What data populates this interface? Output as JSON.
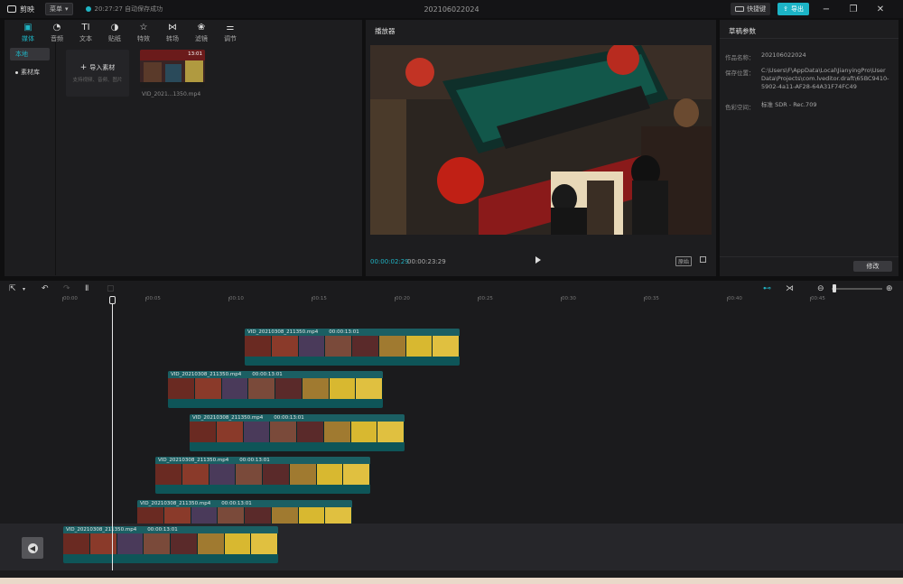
{
  "app": {
    "name": "剪映",
    "menu_label": "菜单",
    "save_status": "20:27:27 自动保存成功",
    "project_title": "202106022024"
  },
  "topbar": {
    "shortcut_label": "快捷键",
    "export_label": "导出"
  },
  "colors": {
    "accent": "#1fb4c4",
    "panel_bg": "#1d1d1f",
    "window_bg": "#0f0f10"
  },
  "media_tabs": [
    {
      "label": "媒体",
      "icon": "media-icon",
      "active": true
    },
    {
      "label": "音频",
      "icon": "audio-icon"
    },
    {
      "label": "文本",
      "icon": "text-icon"
    },
    {
      "label": "贴纸",
      "icon": "sticker-icon"
    },
    {
      "label": "特效",
      "icon": "effects-icon"
    },
    {
      "label": "转场",
      "icon": "transition-icon"
    },
    {
      "label": "滤镜",
      "icon": "filter-icon"
    },
    {
      "label": "调节",
      "icon": "adjust-icon"
    }
  ],
  "media_side": {
    "local": "本地",
    "library": "素材库"
  },
  "media": {
    "import_label": "导入素材",
    "import_hint": "支持视频、音频、图片",
    "clip_name": "VID_2021...1350.mp4",
    "clip_duration": "13:01"
  },
  "player": {
    "title": "播放器",
    "current_time": "00:00:02:29",
    "total_time": "00:00:23:29",
    "ratio_label": "原始"
  },
  "draft": {
    "title": "草稿参数",
    "name_label": "作品名称：",
    "name_value": "202106022024",
    "path_label": "保存位置：",
    "path_value": "C:\\Users\\F\\AppData\\Local\\JianyingPro\\User Data\\Projects\\com.lveditor.draft\\65BC9410-5902-4a11-AF28-64A31F74FC49",
    "color_label": "色彩空间：",
    "color_value": "标准 SDR - Rec.709",
    "modify_label": "修改"
  },
  "timeline": {
    "ticks": [
      "00:00",
      "00:05",
      "00:10",
      "00:15",
      "00:20",
      "00:25",
      "00:30",
      "00:35",
      "00:40",
      "00:45"
    ],
    "clips": [
      {
        "name": "VID_20210308_211350.mp4",
        "duration": "00:00:13:01"
      },
      {
        "name": "VID_20210308_211350.mp4",
        "duration": "00:00:13:01"
      },
      {
        "name": "VID_20210308_211350.mp4",
        "duration": "00:00:13:01"
      },
      {
        "name": "VID_20210308_211350.mp4",
        "duration": "00:00:13:01"
      },
      {
        "name": "VID_20210308_211350.mp4",
        "duration": "00:00:13:01"
      },
      {
        "name": "VID_20210308_211350.mp4",
        "duration": "00:00:13:01"
      }
    ]
  }
}
